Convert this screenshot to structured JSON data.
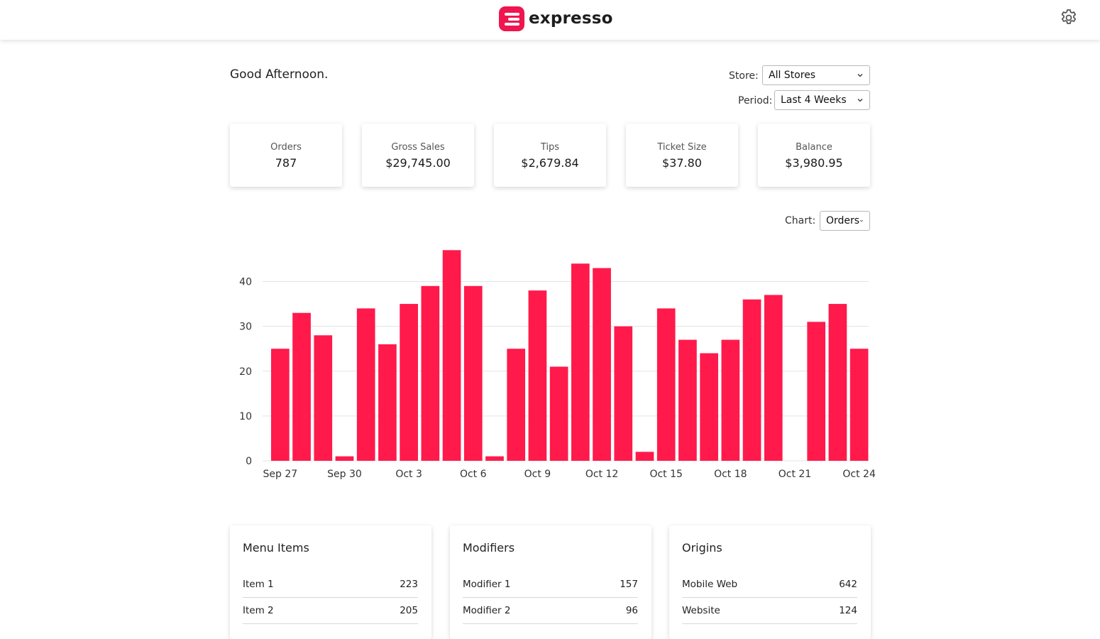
{
  "app": {
    "name": "expresso",
    "accent": "#f0144f"
  },
  "header": {
    "settings_icon": "gear-icon"
  },
  "greeting": "Good Afternoon.",
  "filters": {
    "store_label": "Store:",
    "store_value": "All Stores",
    "period_label": "Period:",
    "period_value": "Last 4 Weeks",
    "chart_label": "Chart:",
    "chart_value": "Orders"
  },
  "kpis": [
    {
      "label": "Orders",
      "value": "787"
    },
    {
      "label": "Gross Sales",
      "value": "$29,745.00"
    },
    {
      "label": "Tips",
      "value": "$2,679.84"
    },
    {
      "label": "Ticket Size",
      "value": "$37.80"
    },
    {
      "label": "Balance",
      "value": "$3,980.95"
    }
  ],
  "chart_data": {
    "type": "bar",
    "categories": [
      "Sep 27",
      "Sep 28",
      "Sep 29",
      "Sep 30",
      "Oct 1",
      "Oct 2",
      "Oct 3",
      "Oct 4",
      "Oct 5",
      "Oct 6",
      "Oct 7",
      "Oct 8",
      "Oct 9",
      "Oct 10",
      "Oct 11",
      "Oct 12",
      "Oct 13",
      "Oct 14",
      "Oct 15",
      "Oct 16",
      "Oct 17",
      "Oct 18",
      "Oct 19",
      "Oct 20",
      "Oct 21",
      "Oct 22",
      "Oct 23",
      "Oct 24"
    ],
    "values": [
      25,
      33,
      28,
      1,
      34,
      26,
      35,
      39,
      47,
      39,
      1,
      25,
      38,
      21,
      44,
      43,
      30,
      2,
      34,
      27,
      24,
      27,
      36,
      37,
      0,
      31,
      35,
      25
    ],
    "x_tick_labels": [
      "Sep 27",
      "Sep 30",
      "Oct 3",
      "Oct 6",
      "Oct 9",
      "Oct 12",
      "Oct 15",
      "Oct 18",
      "Oct 21",
      "Oct 24"
    ],
    "y_ticks": [
      0,
      10,
      20,
      30,
      40
    ],
    "ylim": [
      0,
      48
    ],
    "grid": true,
    "color": "#ff1a4b",
    "title": "",
    "xlabel": "",
    "ylabel": ""
  },
  "panels": [
    {
      "title": "Menu Items",
      "rows": [
        {
          "name": "Item 1",
          "value": "223"
        },
        {
          "name": "Item 2",
          "value": "205"
        }
      ]
    },
    {
      "title": "Modifiers",
      "rows": [
        {
          "name": "Modifier 1",
          "value": "157"
        },
        {
          "name": "Modifier 2",
          "value": "96"
        }
      ]
    },
    {
      "title": "Origins",
      "rows": [
        {
          "name": "Mobile Web",
          "value": "642"
        },
        {
          "name": "Website",
          "value": "124"
        }
      ]
    }
  ]
}
